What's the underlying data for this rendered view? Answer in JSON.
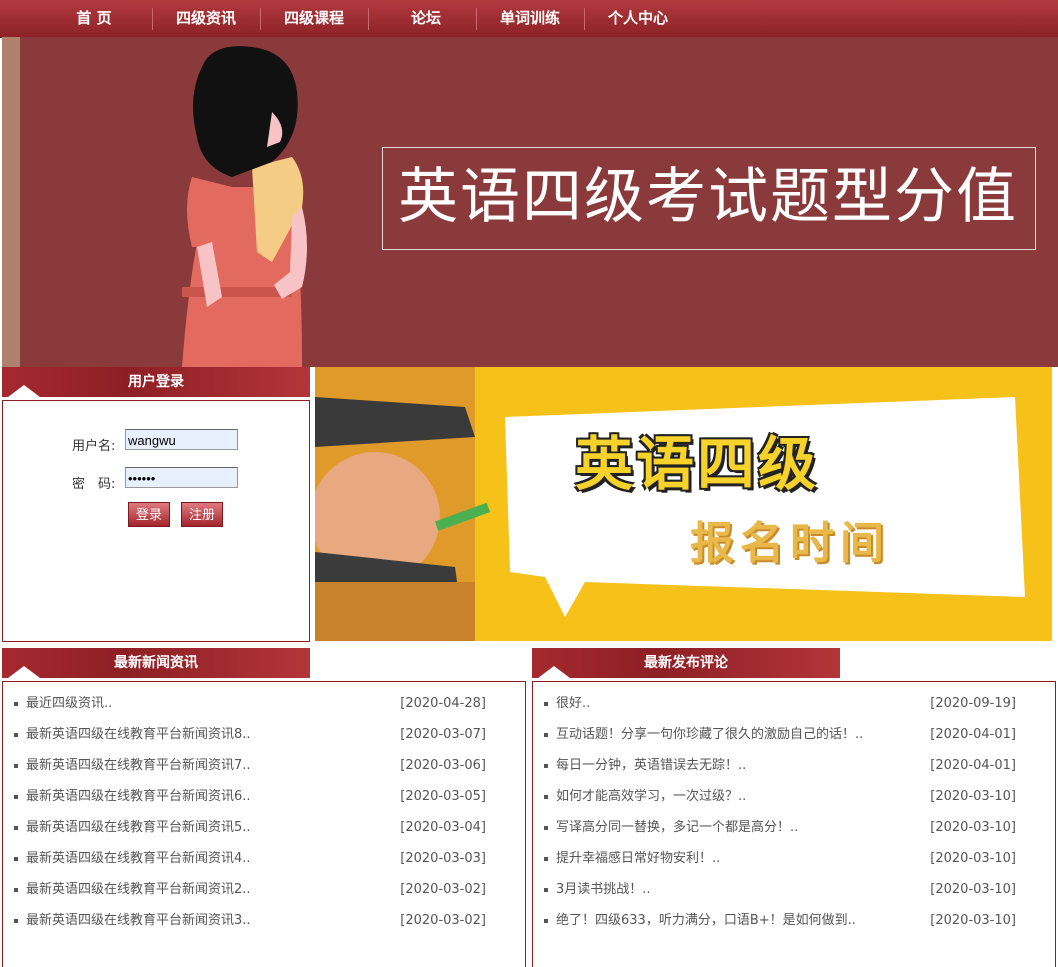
{
  "nav": {
    "items": [
      "首 页",
      "四级资讯",
      "四级课程",
      "论坛",
      "单词训练",
      "个人中心"
    ]
  },
  "banner": {
    "title": "英语四级考试题型分值"
  },
  "login": {
    "title": "用户登录",
    "username_label": "用户名:",
    "username_value": "wangwu",
    "password_label": "密　码:",
    "password_value": "••••••",
    "login_button": "登录",
    "register_button": "注册"
  },
  "ad": {
    "line1": "英语四级",
    "line2": "报名时间"
  },
  "news": {
    "title": "最新新闻资讯",
    "items": [
      {
        "title": "最近四级资讯..",
        "date": "[2020-04-28]"
      },
      {
        "title": "最新英语四级在线教育平台新闻资讯8..",
        "date": "[2020-03-07]"
      },
      {
        "title": "最新英语四级在线教育平台新闻资讯7..",
        "date": "[2020-03-06]"
      },
      {
        "title": "最新英语四级在线教育平台新闻资讯6..",
        "date": "[2020-03-05]"
      },
      {
        "title": "最新英语四级在线教育平台新闻资讯5..",
        "date": "[2020-03-04]"
      },
      {
        "title": "最新英语四级在线教育平台新闻资讯4..",
        "date": "[2020-03-03]"
      },
      {
        "title": "最新英语四级在线教育平台新闻资讯2..",
        "date": "[2020-03-02]"
      },
      {
        "title": "最新英语四级在线教育平台新闻资讯3..",
        "date": "[2020-03-02]"
      }
    ]
  },
  "comments": {
    "title": "最新发布评论",
    "items": [
      {
        "title": "很好..",
        "date": "[2020-09-19]"
      },
      {
        "title": "互动话题！分享一句你珍藏了很久的激励自己的话！..",
        "date": "[2020-04-01]"
      },
      {
        "title": "每日一分钟，英语错误去无踪！..",
        "date": "[2020-04-01]"
      },
      {
        "title": "如何才能高效学习，一次过级？..",
        "date": "[2020-03-10]"
      },
      {
        "title": "写译高分同一替换，多记一个都是高分！..",
        "date": "[2020-03-10]"
      },
      {
        "title": "提升幸福感日常好物安利！..",
        "date": "[2020-03-10]"
      },
      {
        "title": "3月读书挑战！..",
        "date": "[2020-03-10]"
      },
      {
        "title": "绝了！四级633，听力满分，口语B+！是如何做到..",
        "date": "[2020-03-10]"
      }
    ]
  },
  "colors": {
    "nav": "#9c2a2f",
    "banner_bg": "#8a3a3a",
    "ad_bg": "#f6c21a",
    "accent": "#8d1f24"
  }
}
